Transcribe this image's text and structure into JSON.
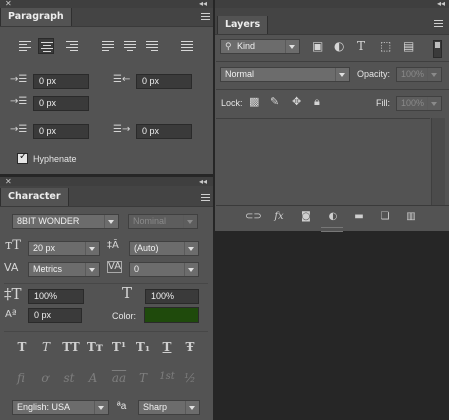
{
  "paragraph_panel": {
    "tab_label": "Paragraph",
    "indent_left": "0 px",
    "indent_right": "0 px",
    "indent_first_line": "0 px",
    "space_before": "0 px",
    "space_after": "0 px",
    "hyphenate_label": "Hyphenate",
    "hyphenate_checked": true
  },
  "character_panel": {
    "tab_label": "Character",
    "font_family": "8BIT WONDER",
    "font_style": "Nominal",
    "font_size": "20 px",
    "leading": "(Auto)",
    "kerning": "Metrics",
    "tracking": "0",
    "vertical_scale": "100%",
    "horizontal_scale": "100%",
    "baseline_shift": "0 px",
    "color_label": "Color:",
    "color_value": "#1f4a0c",
    "language": "English: USA",
    "antialias_symbol": "ªa",
    "antialias": "Sharp",
    "style_buttons": [
      "T",
      "T",
      "TT",
      "Tт",
      "T¹",
      "T₁",
      "T",
      "Ŧ"
    ],
    "opentype_buttons": [
      "fi",
      "ơ",
      "st",
      "A",
      "aa",
      "T",
      "1st",
      "½"
    ]
  },
  "layers_panel": {
    "tab_label": "Layers",
    "filter_kind": "Kind",
    "blend_mode": "Normal",
    "opacity_label": "Opacity:",
    "opacity_value": "100%",
    "lock_label": "Lock:",
    "fill_label": "Fill:",
    "fill_value": "100%",
    "footer_fx": "fx"
  },
  "colors": {
    "panel_bg": "#535353",
    "app_bg": "#262626",
    "field_bg": "#3a3a3a"
  }
}
